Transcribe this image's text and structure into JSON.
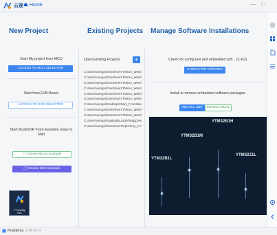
{
  "titlebar": {
    "logo_text": "云途",
    "home_label": "Home"
  },
  "window": {
    "minimize": "—",
    "maximize": "□"
  },
  "new_project": {
    "title": "New Project",
    "mcu_label": "Start My project from MCU",
    "mcu_button": "ACCESS TO MCU SELECTOR",
    "evb_label": "Start from EVB-Board",
    "evb_button": "ACCESS TO EVB SELECTOR",
    "example_label_1": "Start Mcal/SDK From Example, Easy to",
    "example_label_2": "Start",
    "mcal_example_button": "Choose MCAL Example",
    "sdk_example_button": "Choose SDK Example"
  },
  "existing_projects": {
    "title": "Existing Projects",
    "open_label": "Open Existing Projects",
    "add_glyph": "+",
    "files": [
      "C:\\Users\\cengxi\\OneDrive\\YTMicro_Work\\",
      "C:\\Users\\cengxi\\OneDrive\\YTMicro_Work\\",
      "C:\\Users\\cengxi\\OneDrive\\YTMicro_Work\\",
      "C:\\Users\\cengxi\\OneDrive\\YTMicro_Work\\",
      "C:\\Users\\cengxi\\OneDrive\\YTMicro_Work\\",
      "C:\\Users\\cengxi\\OneDrive\\YTMicro_Work\\",
      "C:\\Users\\cengxi\\Desktop\\Chery_From\\Bestr",
      "C:\\Users\\cengxi\\OneDrive\\YTMicro_Work\\",
      "C:\\Users\\cengxi\\OneDrive\\YTMicro_Work\\",
      "C:\\Users\\cengxi\\AppData\\Local\\Temp\\TAM",
      "C:\\Users\\cengxi\\OneDrive\\Tmp\\Chery_Fro"
    ],
    "more_text": "more"
  },
  "software": {
    "title": "Manage Software Installations",
    "check_label": "Check for config tool and embedded soft... (2.4.0)",
    "check_button": "CHECK FOR UPDATES",
    "install_label": "Install or remove embedded software packages",
    "install_sdk": "INSTALL SDK",
    "install_mcal": "INSTALL MCAL",
    "chips": [
      {
        "name": "YTM32B1H"
      },
      {
        "name": "YTM32B1M"
      },
      {
        "name": "YTM32B1L"
      },
      {
        "name": "YTM32Z1L"
      }
    ]
  },
  "app_icon": {
    "line1": "YT Config",
    "line2": "Tool"
  },
  "status": {
    "label": "Problems",
    "count": "0 W 0 I 0"
  },
  "colors": {
    "accent": "#3b86f0",
    "title": "#1f5fa8",
    "green": "#2f9a48",
    "purple": "#6a62e6"
  }
}
